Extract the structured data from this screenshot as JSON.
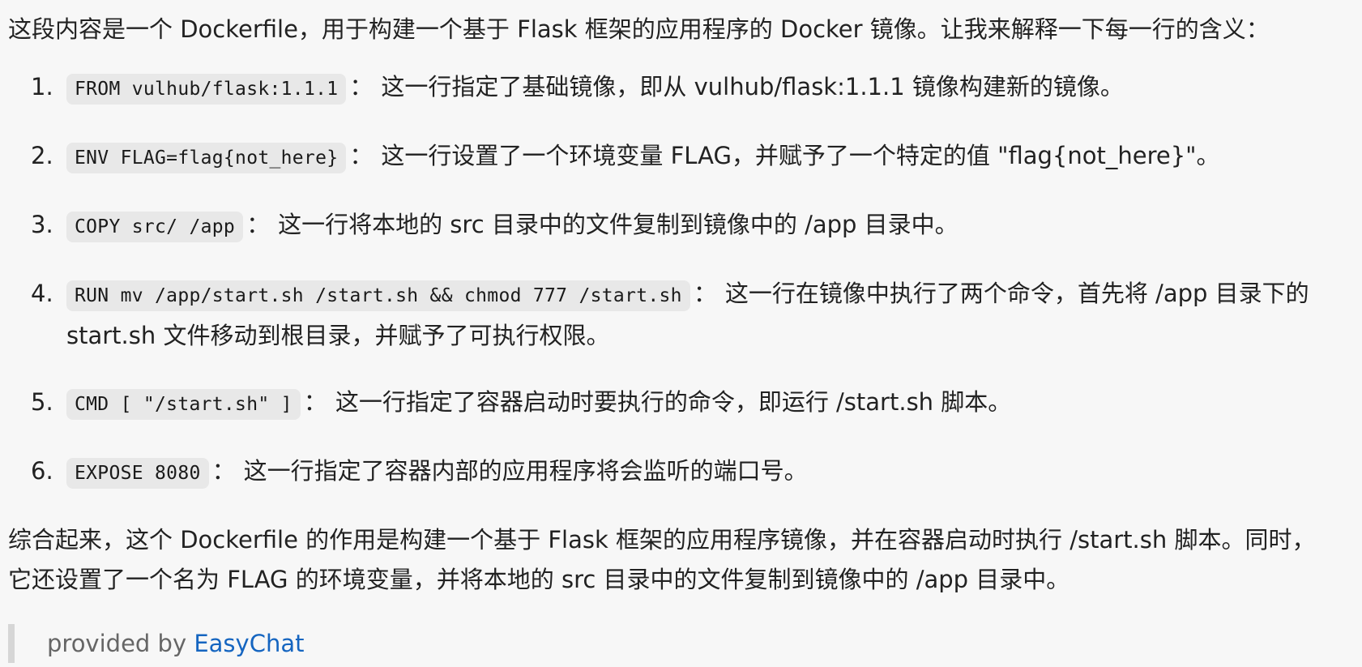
{
  "intro": "这段内容是一个 Dockerfile，用于构建一个基于 Flask 框架的应用程序的 Docker 镜像。让我来解释一下每一行的含义：",
  "items": [
    {
      "num": "1.",
      "code": "FROM vulhub/flask:1.1.1",
      "sep": "：",
      "text": "这一行指定了基础镜像，即从 vulhub/flask:1.1.1 镜像构建新的镜像。"
    },
    {
      "num": "2.",
      "code": "ENV FLAG=flag{not_here}",
      "sep": "：",
      "text": "这一行设置了一个环境变量 FLAG，并赋予了一个特定的值 \"flag{not_here}\"。"
    },
    {
      "num": "3.",
      "code": "COPY src/ /app",
      "sep": "：",
      "text": "这一行将本地的 src 目录中的文件复制到镜像中的 /app 目录中。"
    },
    {
      "num": "4.",
      "code": "RUN mv /app/start.sh /start.sh && chmod 777 /start.sh",
      "sep": "：",
      "text": "这一行在镜像中执行了两个命令，首先将 /app 目录下的 start.sh 文件移动到根目录，并赋予了可执行权限。"
    },
    {
      "num": "5.",
      "code": "CMD [ \"/start.sh\" ]",
      "sep": "：",
      "text": "这一行指定了容器启动时要执行的命令，即运行 /start.sh 脚本。"
    },
    {
      "num": "6.",
      "code": "EXPOSE 8080",
      "sep": "：",
      "text": "这一行指定了容器内部的应用程序将会监听的端口号。"
    }
  ],
  "summary": "综合起来，这个 Dockerfile 的作用是构建一个基于 Flask 框架的应用程序镜像，并在容器启动时执行 /start.sh 脚本。同时，它还设置了一个名为 FLAG 的环境变量，并将本地的 src 目录中的文件复制到镜像中的 /app 目录中。",
  "footer": {
    "prefix": "provided by ",
    "link": "EasyChat"
  },
  "colors": {
    "background": "#f7f7f7",
    "text": "#222222",
    "code_background": "#e8e8e8",
    "link": "#1565c0",
    "quote_border": "#d6d6d6"
  }
}
